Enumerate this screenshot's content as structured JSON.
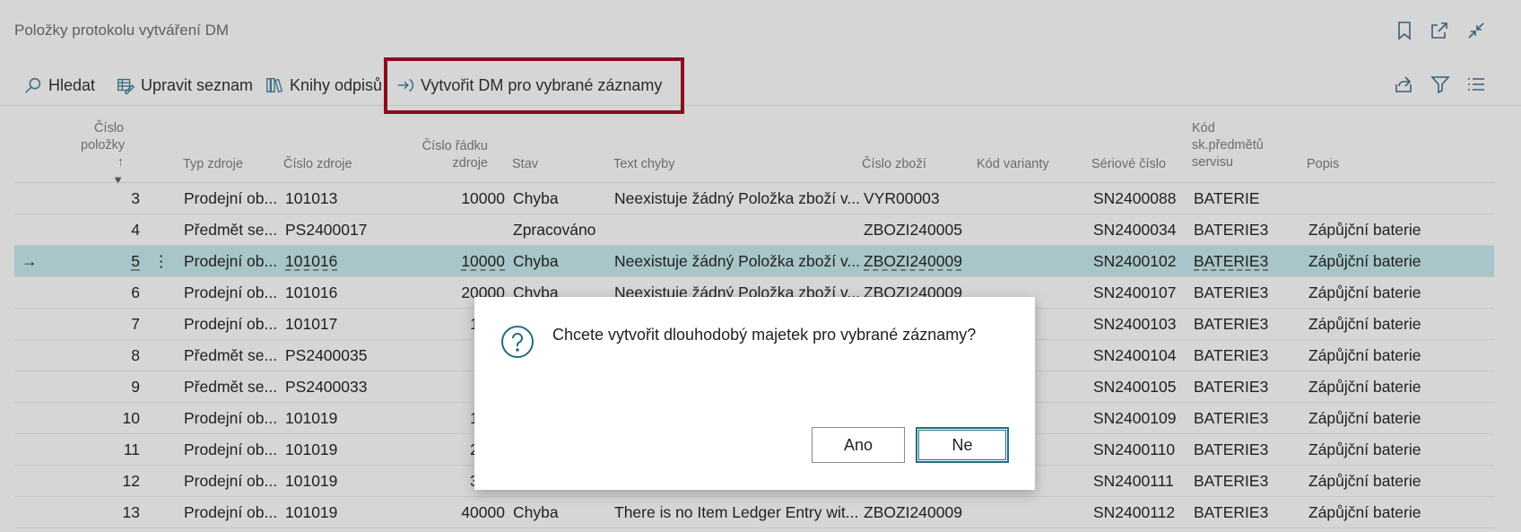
{
  "window": {
    "title": "Položky protokolu vytváření DM"
  },
  "actions": {
    "search": "Hledat",
    "edit_list": "Upravit seznam",
    "depr_books": "Knihy odpisů",
    "create_fa": "Vytvořit DM pro vybrané záznamy"
  },
  "columns": {
    "entry_no_line1": "Číslo",
    "entry_no_line2": "položky ↑",
    "source_type": "Typ zdroje",
    "source_no": "Číslo zdroje",
    "source_line_no_1": "Číslo řádku",
    "source_line_no_2": "zdroje",
    "status": "Stav",
    "error_text": "Text chyby",
    "item_no": "Číslo zboží",
    "variant_code": "Kód varianty",
    "serial_no": "Sériové číslo",
    "service_group_1": "Kód",
    "service_group_2": "sk.předmětů",
    "service_group_3": "servisu",
    "description": "Popis"
  },
  "rows": [
    {
      "no": "3",
      "type": "Prodejní ob...",
      "src": "101013",
      "line": "10000",
      "status": "Chyba",
      "error": "Neexistuje žádný Položka zboží v...",
      "item": "VYR00003",
      "variant": "",
      "serial": "SN2400088",
      "group": "BATERIE",
      "desc": ""
    },
    {
      "no": "4",
      "type": "Předmět se...",
      "src": "PS2400017",
      "line": "",
      "status": "Zpracováno",
      "error": "",
      "item": "ZBOZI240005",
      "variant": "",
      "serial": "SN2400034",
      "group": "BATERIE3",
      "desc": "Zápůjční baterie"
    },
    {
      "no": "5",
      "type": "Prodejní ob...",
      "src": "101016",
      "line": "10000",
      "status": "Chyba",
      "error": "Neexistuje žádný Položka zboží v...",
      "item": "ZBOZI240009",
      "variant": "",
      "serial": "SN2400102",
      "group": "BATERIE3",
      "desc": "Zápůjční baterie"
    },
    {
      "no": "6",
      "type": "Prodejní ob...",
      "src": "101016",
      "line": "20000",
      "status": "Chyba",
      "error": "Neexistuje žádný Položka zboží v...",
      "item": "ZBOZI240009",
      "variant": "",
      "serial": "SN2400107",
      "group": "BATERIE3",
      "desc": "Zápůjční baterie"
    },
    {
      "no": "7",
      "type": "Prodejní ob...",
      "src": "101017",
      "line": "1000",
      "status": "",
      "error": "",
      "item": "",
      "variant": "",
      "serial": "SN2400103",
      "group": "BATERIE3",
      "desc": "Zápůjční baterie"
    },
    {
      "no": "8",
      "type": "Předmět se...",
      "src": "PS2400035",
      "line": "",
      "status": "",
      "error": "",
      "item": "",
      "variant": "",
      "serial": "SN2400104",
      "group": "BATERIE3",
      "desc": "Zápůjční baterie"
    },
    {
      "no": "9",
      "type": "Předmět se...",
      "src": "PS2400033",
      "line": "",
      "status": "",
      "error": "",
      "item": "",
      "variant": "",
      "serial": "SN2400105",
      "group": "BATERIE3",
      "desc": "Zápůjční baterie"
    },
    {
      "no": "10",
      "type": "Prodejní ob...",
      "src": "101019",
      "line": "1000",
      "status": "",
      "error": "",
      "item": "",
      "variant": "",
      "serial": "SN2400109",
      "group": "BATERIE3",
      "desc": "Zápůjční baterie"
    },
    {
      "no": "11",
      "type": "Prodejní ob...",
      "src": "101019",
      "line": "2000",
      "status": "",
      "error": "",
      "item": "",
      "variant": "",
      "serial": "SN2400110",
      "group": "BATERIE3",
      "desc": "Zápůjční baterie"
    },
    {
      "no": "12",
      "type": "Prodejní ob...",
      "src": "101019",
      "line": "3000",
      "status": "",
      "error": "",
      "item": "",
      "variant": "",
      "serial": "SN2400111",
      "group": "BATERIE3",
      "desc": "Zápůjční baterie"
    },
    {
      "no": "13",
      "type": "Prodejní ob...",
      "src": "101019",
      "line": "40000",
      "status": "Chyba",
      "error": "There is no Item Ledger Entry wit...",
      "item": "ZBOZI240009",
      "variant": "",
      "serial": "SN2400112",
      "group": "BATERIE3",
      "desc": "Zápůjční baterie"
    }
  ],
  "dialog": {
    "message": "Chcete vytvořit dlouhodobý majetek pro vybrané záznamy?",
    "yes": "Ano",
    "no": "Ne"
  },
  "colors": {
    "accent": "#1f6f80",
    "highlight_border": "#8a0d1e",
    "selected_row": "#a8c6c9"
  }
}
